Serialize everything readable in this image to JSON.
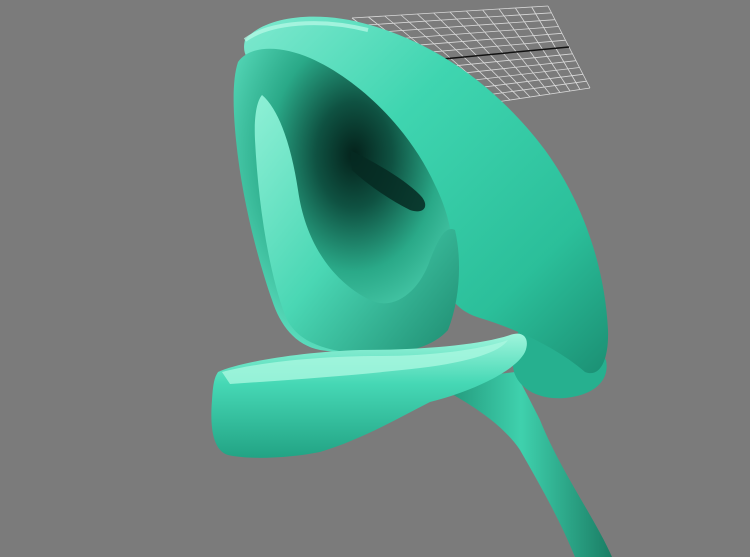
{
  "viewport": {
    "background_color": "#7b7b7b",
    "grid_color": "#d9d9d9",
    "grid_axis_color": "#111111"
  },
  "model": {
    "base_color": "#3ed6b2",
    "highlight_color": "#9ff5dc",
    "shadow_color": "#12644f",
    "deep_shadow_color": "#04221b"
  }
}
